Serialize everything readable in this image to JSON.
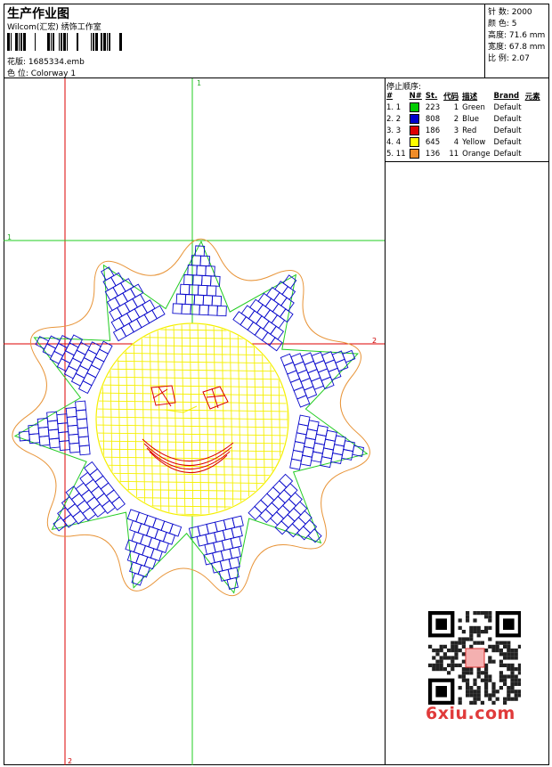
{
  "header": {
    "title": "生产作业图",
    "company": "Wilcom(汇宏) 绣饰工作室",
    "design_label": "花版: 1685334.emb",
    "colorway_label": "色 位:  Colorway 1"
  },
  "stats": [
    {
      "label": "针 数: 2000"
    },
    {
      "label": "颜 色: 5"
    },
    {
      "label": "高度: 71.6 mm"
    },
    {
      "label": "宽度: 67.8 mm"
    },
    {
      "label": "比 例: 2.07"
    }
  ],
  "legend": {
    "title": "停止顺序:",
    "headers": [
      "#",
      "N#",
      "St.",
      "代码",
      "描述",
      "Brand",
      "元素"
    ],
    "rows": [
      {
        "idx": "1. 1",
        "st": "223",
        "code": "1",
        "name": "Green",
        "brand": "Default",
        "color": "#00cc00"
      },
      {
        "idx": "2. 2",
        "st": "808",
        "code": "2",
        "name": "Blue",
        "brand": "Default",
        "color": "#0000cc"
      },
      {
        "idx": "3. 3",
        "st": "186",
        "code": "3",
        "name": "Red",
        "brand": "Default",
        "color": "#dd0000"
      },
      {
        "idx": "4. 4",
        "st": "645",
        "code": "4",
        "name": "Yellow",
        "brand": "Default",
        "color": "#ffff00"
      },
      {
        "idx": "5. 11",
        "st": "136",
        "code": "11",
        "name": "Orange",
        "brand": "Default",
        "color": "#f08c28"
      }
    ]
  },
  "guides": {
    "label_1": "1",
    "label_2": "2"
  },
  "watermark": {
    "site": "6xiu.com"
  },
  "colors": {
    "green": "#22cc22",
    "red": "#dd0000",
    "orange": "#e8953a",
    "blue": "#0a0acc",
    "yellow": "#f5f000"
  }
}
